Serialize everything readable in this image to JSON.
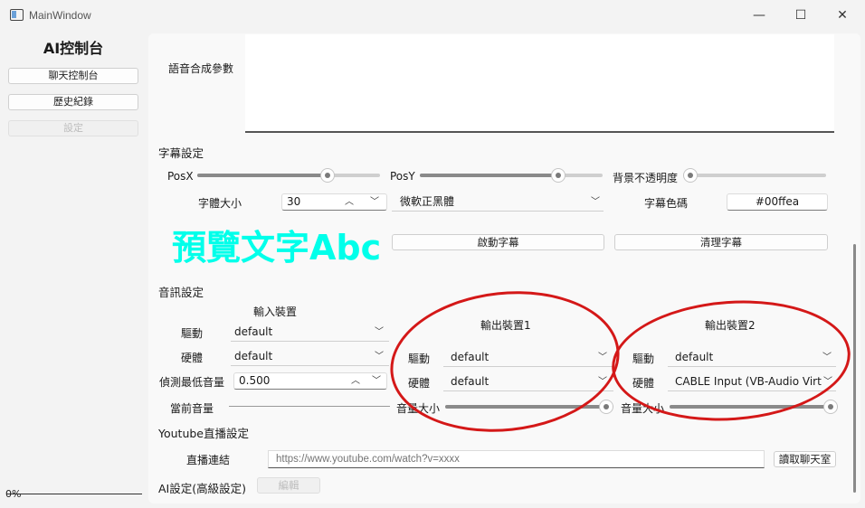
{
  "window": {
    "title": "MainWindow",
    "minimize_glyph": "—",
    "maximize_glyph": "☐",
    "close_glyph": "✕"
  },
  "sidebar": {
    "title": "AI控制台",
    "items": [
      {
        "label": "聊天控制台",
        "enabled": true
      },
      {
        "label": "歷史紀錄",
        "enabled": true
      },
      {
        "label": "設定",
        "enabled": false
      }
    ],
    "progress_text": "0%",
    "progress_value": 0
  },
  "tts": {
    "label": "語音合成參數",
    "value": ""
  },
  "subtitle": {
    "section_label": "字幕設定",
    "posx_label": "PosX",
    "posx_value": 0.73,
    "posy_label": "PosY",
    "posy_value": 0.78,
    "opacity_label": "背景不透明度",
    "opacity_value": 0.0,
    "font_size_label": "字體大小",
    "font_size_value": "30",
    "font_family_value": "微軟正黑體",
    "color_label": "字幕色碼",
    "color_value": "#00ffea",
    "preview_text": "預覽文字Abc",
    "start_button": "啟動字幕",
    "clear_button": "清理字幕"
  },
  "audio": {
    "section_label": "音訊設定",
    "input_device_header": "輸入裝置",
    "output1_header": "輸出裝置1",
    "output2_header": "輸出裝置2",
    "driver_label": "驅動",
    "hardware_label": "硬體",
    "min_volume_label": "偵測最低音量",
    "current_volume_label": "當前音量",
    "volume_label": "音量大小",
    "input_driver": "default",
    "input_hardware": "default",
    "min_volume_value": "0.500",
    "current_volume_value": 0,
    "output1_driver": "default",
    "output1_hardware": "default",
    "output1_volume": 1.0,
    "output2_driver": "default",
    "output2_hardware": "CABLE Input (VB-Audio Virtual Cable)",
    "output2_volume": 1.0
  },
  "youtube": {
    "section_label": "Youtube直播設定",
    "link_label": "直播連結",
    "link_placeholder": "https://www.youtube.com/watch?v=xxxx",
    "read_chat_button": "讀取聊天室"
  },
  "ai": {
    "section_label": "AI設定(高級設定)",
    "advanced_button": "編輯"
  },
  "colors": {
    "preview": "#00ffea",
    "annotation": "#d41818"
  },
  "icons": {
    "combo_arrow": "chevron-down-icon",
    "spin_up": "chevron-up-icon",
    "spin_down": "chevron-down-icon"
  }
}
